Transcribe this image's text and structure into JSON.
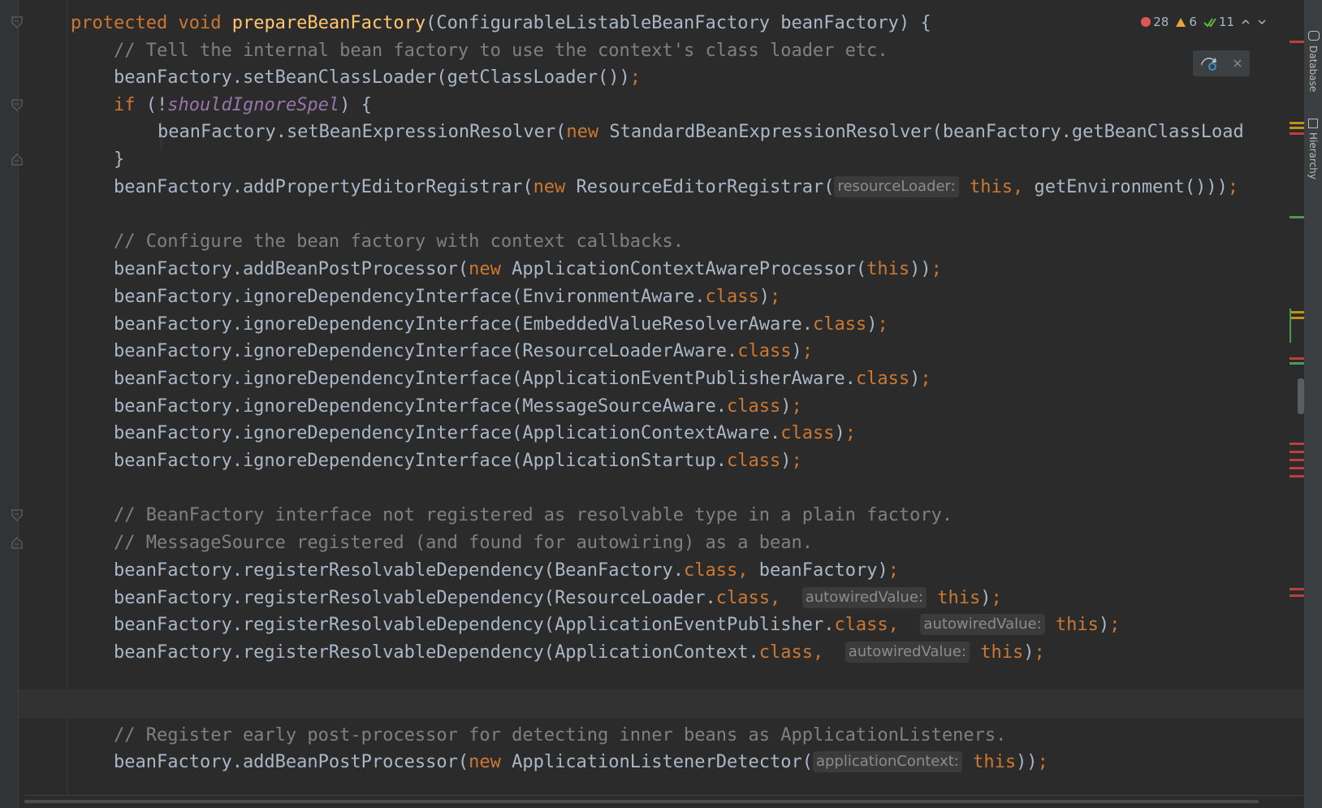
{
  "inspection": {
    "errors": "28",
    "warnings": "6",
    "ok": "11"
  },
  "tool_windows": {
    "database": "Database",
    "hierarchy": "Hierarchy"
  },
  "hints": {
    "resource_loader": "resourceLoader:",
    "autowired_value": "autowiredValue:",
    "application_context": "applicationContext:"
  },
  "code": {
    "l1_kw1": "protected",
    "l1_kw2": "void",
    "l1_fn": "prepareBeanFactory",
    "l1_rest": "(ConfigurableListableBeanFactory beanFactory) {",
    "l2": "// Tell the internal bean factory to use the context's class loader etc.",
    "l3_code": "beanFactory.setBeanClassLoader(getClassLoader())",
    "l4_kw": "if",
    "l4_paren": " (!",
    "l4_field": "shouldIgnoreSpel",
    "l4_rest": ") {",
    "l5_a": "beanFactory.setBeanExpressionResolver(",
    "l5_b": " StandardBeanExpressionResolver(beanFactory.getBeanClassLoad",
    "l6": "}",
    "l7_a": "beanFactory.addPropertyEditorRegistrar(",
    "l7_b": " ResourceEditorRegistrar(",
    "l7_c": " getEnvironment()))",
    "l9": "// Configure the bean factory with context callbacks.",
    "l10_a": "beanFactory.addBeanPostProcessor(",
    "l10_b": " ApplicationContextAwareProcessor(",
    "l10_c": "))",
    "ignore_prefix": "beanFactory.ignoreDependencyInterface(",
    "l11_t": "EnvironmentAware.",
    "l12_t": "EmbeddedValueResolverAware.",
    "l13_t": "ResourceLoaderAware.",
    "l14_t": "ApplicationEventPublisherAware.",
    "l15_t": "MessageSourceAware.",
    "l16_t": "ApplicationContextAware.",
    "l17_t": "ApplicationStartup.",
    "l19": "// BeanFactory interface not registered as resolvable type in a plain factory.",
    "l20": "// MessageSource registered (and found for autowiring) as a bean.",
    "register_prefix": "beanFactory.registerResolvableDependency(",
    "l21_t": "BeanFactory.",
    "l21_rest": " beanFactory)",
    "l22_t": "ResourceLoader.",
    "l23_t": "ApplicationEventPublisher.",
    "l24_t": "ApplicationContext.",
    "l26": "// Register early post-processor for detecting inner beans as ApplicationListeners.",
    "l27_b": " ApplicationListenerDetector(",
    "kw_new": "new",
    "kw_this": "this",
    "kw_class": "class",
    "semi": ";",
    "comma": ",",
    "close_paren": ")",
    "double_close": "))"
  }
}
